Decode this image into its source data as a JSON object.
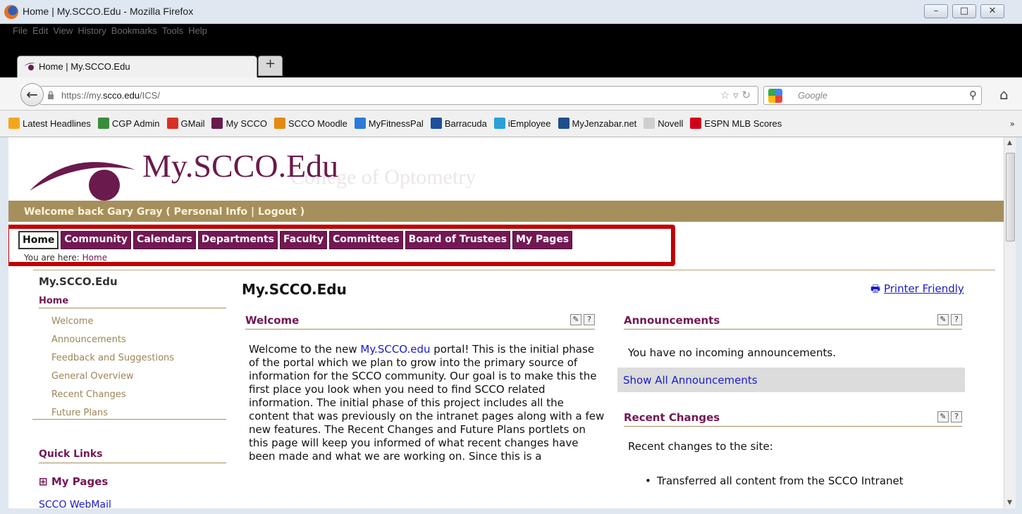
{
  "window": {
    "title": "Home | My.SCCO.Edu - Mozilla Firefox"
  },
  "menu": [
    "File",
    "Edit",
    "View",
    "History",
    "Bookmarks",
    "Tools",
    "Help"
  ],
  "tab": {
    "title": "Home | My.SCCO.Edu",
    "new_tab": "+"
  },
  "address": {
    "prefix": "https://my.",
    "domain": "scco.edu",
    "path": "/ICS/"
  },
  "search": {
    "placeholder": "Google"
  },
  "bookmarks": [
    {
      "label": "Latest Headlines",
      "color": "#f2a71b"
    },
    {
      "label": "CGP Admin",
      "color": "#3a8c3a"
    },
    {
      "label": "GMail",
      "color": "#d93025"
    },
    {
      "label": "My SCCO",
      "color": "#6a1a4c"
    },
    {
      "label": "SCCO Moodle",
      "color": "#e38a12"
    },
    {
      "label": "MyFitnessPal",
      "color": "#2c7ad9"
    },
    {
      "label": "Barracuda",
      "color": "#1e4f9c"
    },
    {
      "label": "iEmployee",
      "color": "#2aa0d8"
    },
    {
      "label": "MyJenzabar.net",
      "color": "#1f4e8c"
    },
    {
      "label": "Novell",
      "color": "#cfcfcf"
    },
    {
      "label": "ESPN MLB Scores",
      "color": "#d0021b"
    }
  ],
  "site": {
    "title": "My.SCCO.Edu",
    "ghost_text": "College of Optometry",
    "welcome": "Welcome back Gary Gray ( Personal Info | Logout )",
    "tabs": [
      "Home",
      "Community",
      "Calendars",
      "Departments",
      "Faculty",
      "Committees",
      "Board of Trustees",
      "My Pages"
    ],
    "breadcrumb_label": "You are here:",
    "breadcrumb_link": "Home"
  },
  "sidebar": {
    "title": "My.SCCO.Edu",
    "home": "Home",
    "items": [
      "Welcome",
      "Announcements",
      "Feedback and Suggestions",
      "General Overview",
      "Recent Changes",
      "Future Plans"
    ],
    "quick_links": "Quick Links",
    "my_pages": "My Pages",
    "webmail": "SCCO WebMail"
  },
  "main": {
    "title": "My.SCCO.Edu",
    "printer": "Printer Friendly",
    "welcome_head": "Welcome",
    "welcome_pre": "Welcome to the new ",
    "welcome_link": "My.SCCO.edu",
    "welcome_body": " portal! This is the initial phase of the portal which we plan to grow into the primary source of information for the SCCO community. Our goal is to make this the first place you look when you need to find SCCO related information. The initial phase of this project includes all the content that was previously on the intranet pages along with a few new features. The Recent Changes and Future Plans portlets on this page will keep you informed of what recent changes have been made and what we are working on. Since this is a",
    "ann_head": "Announcements",
    "ann_body": "You have no incoming announcements.",
    "show_all": "Show All Announcements",
    "rc_head": "Recent Changes",
    "rc_body": "Recent changes to the site:",
    "rc_items": [
      "Transferred all content from the SCCO Intranet"
    ]
  }
}
